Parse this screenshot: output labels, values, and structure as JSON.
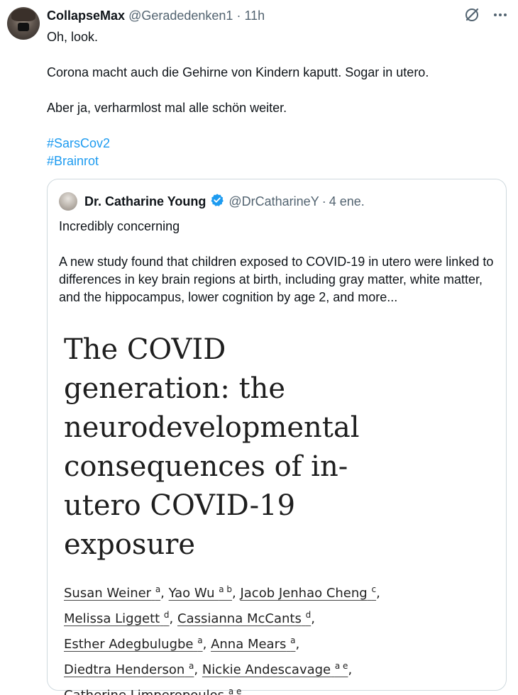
{
  "tweet": {
    "display_name": "CollapseMax",
    "handle": "@Geradedenken1",
    "separator": "·",
    "time": "11h",
    "lines": [
      "Oh, look.",
      "Corona macht auch die Gehirne von Kindern kaputt. Sogar in utero.",
      "Aber ja, verharmlost mal alle schön weiter."
    ],
    "hashtags": [
      "#SarsCov2",
      "#Brainrot"
    ]
  },
  "quote": {
    "display_name": "Dr. Catharine Young",
    "handle": "@DrCatharineY",
    "separator": "·",
    "time": "4 ene.",
    "lines": [
      "Incredibly concerning",
      "A new study found that children exposed to COVID-19 in utero were linked to differences in key brain regions at birth, including gray matter, white matter, and the hippocampus, lower cognition by age 2, and more..."
    ],
    "paper_title": "The COVID generation: the neurodevelopmental consequences of in-utero COVID-19 exposure",
    "authors": [
      {
        "name": "Susan Weiner",
        "sup": "a",
        "sep": ", "
      },
      {
        "name": "Yao Wu",
        "sup": "a b",
        "sep": ", "
      },
      {
        "name": "Jacob Jenhao Cheng",
        "sup": "c",
        "sep": ","
      },
      {
        "name": "Melissa Liggett",
        "sup": "d",
        "sep": ", "
      },
      {
        "name": "Cassianna McCants",
        "sup": "d",
        "sep": ","
      },
      {
        "name": "Esther Adegbulugbe",
        "sup": "a",
        "sep": ", "
      },
      {
        "name": "Anna Mears",
        "sup": "a",
        "sep": ","
      },
      {
        "name": "Diedtra Henderson",
        "sup": "a",
        "sep": ", "
      },
      {
        "name": "Nickie Andescavage",
        "sup": "a e",
        "sep": ","
      },
      {
        "name": "Catherine Limperopoulos",
        "sup": "a e",
        "sep": ""
      }
    ]
  },
  "icons": {
    "grok": "grok-icon",
    "more": "more-icon",
    "verified": "verified-badge-icon"
  },
  "colors": {
    "link": "#1d9bf0",
    "secondary_text": "#536471",
    "border": "#cfd9de"
  }
}
